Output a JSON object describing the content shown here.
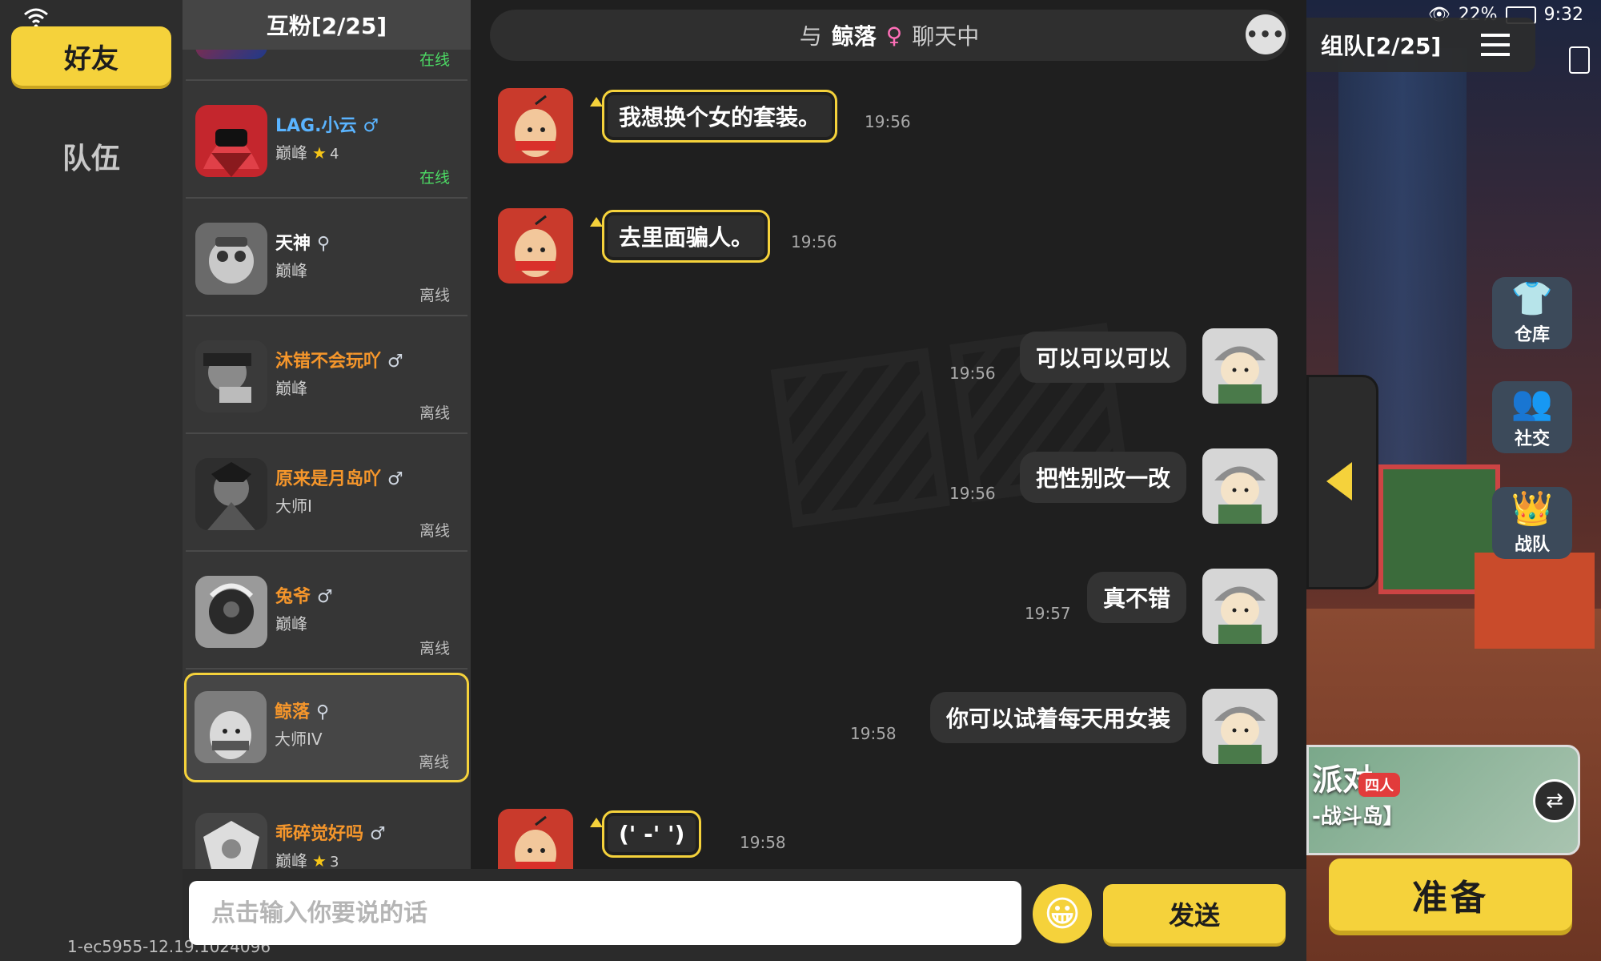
{
  "left_rail": {
    "tab_friends": "好友",
    "tab_team": "队伍",
    "version": "1-ec5955-12.19.1024096"
  },
  "friends": {
    "title": "互粉[2/25]",
    "items": [
      {
        "name": "",
        "gender": "",
        "rank": "",
        "stars": "",
        "status": "在线"
      },
      {
        "name": "LAG.小云",
        "gender": "♂",
        "rank": "巅峰",
        "stars": "4",
        "status": "在线"
      },
      {
        "name": "天神",
        "gender": "⚲",
        "rank": "巅峰",
        "stars": "",
        "status": "离线"
      },
      {
        "name": "沐错不会玩吖",
        "gender": "♂",
        "rank": "巅峰",
        "stars": "",
        "status": "离线"
      },
      {
        "name": "原来是月岛吖",
        "gender": "♂",
        "rank": "大师I",
        "stars": "",
        "status": "离线"
      },
      {
        "name": "兔爷",
        "gender": "♂",
        "rank": "巅峰",
        "stars": "",
        "status": "离线"
      },
      {
        "name": "鲸落",
        "gender": "⚲",
        "rank": "大师IV",
        "stars": "",
        "status": "离线"
      },
      {
        "name": "乖碎觉好吗",
        "gender": "♂",
        "rank": "巅峰",
        "stars": "3",
        "status": "离线"
      }
    ]
  },
  "chat": {
    "header_prefix": "与",
    "peer_name": "鲸落",
    "peer_gender": "♀",
    "header_suffix": "聊天中",
    "messages": [
      {
        "side": "left",
        "text": "我想换个女的套装。",
        "time": "19:56"
      },
      {
        "side": "left",
        "text": "去里面骗人。",
        "time": "19:56"
      },
      {
        "side": "right",
        "text": "可以可以可以",
        "time": "19:56"
      },
      {
        "side": "right",
        "text": "把性别改一改",
        "time": "19:56"
      },
      {
        "side": "right",
        "text": "真不错",
        "time": "19:57"
      },
      {
        "side": "right",
        "text": "你可以试着每天用女装",
        "time": "19:58"
      },
      {
        "side": "left",
        "text": "(' -' ')",
        "time": "19:58"
      }
    ],
    "input_placeholder": "点击输入你要说的话",
    "send_label": "发送"
  },
  "game": {
    "status": {
      "battery": "22%",
      "time": "9:32"
    },
    "team_title": "组队[2/25]",
    "side_buttons": [
      "仓库",
      "社交",
      "战队"
    ],
    "mode": {
      "title": "派对",
      "badge": "四人",
      "subtitle": "-战斗岛】"
    },
    "ready_label": "准备"
  },
  "colors": {
    "accent": "#f5d23b",
    "online": "#4cd964",
    "name_orange": "#f5962b",
    "name_blue": "#5ab4ff"
  }
}
